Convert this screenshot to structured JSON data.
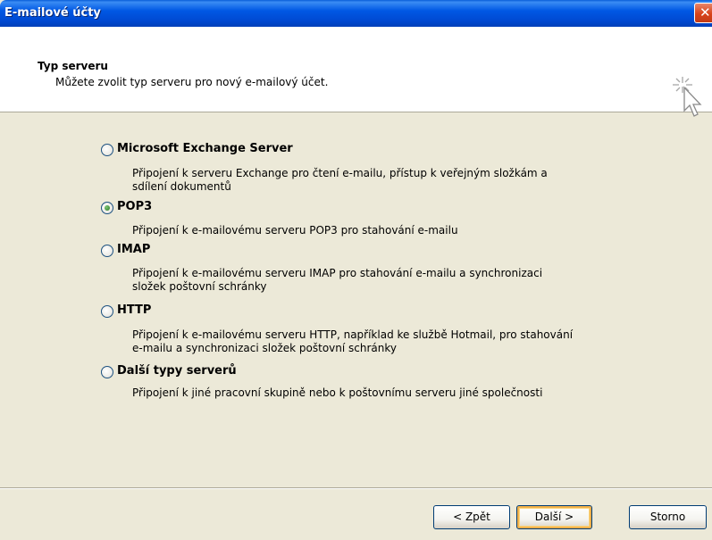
{
  "window": {
    "title": "E-mailové účty",
    "close_glyph": "✕"
  },
  "header": {
    "title": "Typ serveru",
    "subtitle": "Můžete zvolit typ serveru pro nový e-mailový účet.",
    "icon": "wizard-cursor-icon"
  },
  "options": [
    {
      "label": "Microsoft Exchange Server",
      "desc1": "Připojení k serveru Exchange pro čtení e-mailu, přístup k veřejným složkám a",
      "desc2": "sdílení dokumentů",
      "checked": false
    },
    {
      "label": "POP3",
      "desc1": "Připojení k e-mailovému serveru POP3 pro stahování e-mailu",
      "desc2": "",
      "checked": true
    },
    {
      "label": "IMAP",
      "desc1": "Připojení k e-mailovému serveru IMAP pro stahování e-mailu a synchronizaci",
      "desc2": "složek poštovní schránky",
      "checked": false
    },
    {
      "label": "HTTP",
      "desc1": "Připojení k e-mailovému serveru HTTP, například ke službě Hotmail, pro stahování",
      "desc2": "e-mailu a synchronizaci složek poštovní schránky",
      "checked": false
    },
    {
      "label": "Další typy serverů",
      "desc1": "Připojení k jiné pracovní skupině nebo k poštovnímu serveru jiné společnosti",
      "desc2": "",
      "checked": false
    }
  ],
  "buttons": {
    "back": "< Zpět",
    "next": "Další >",
    "cancel": "Storno"
  }
}
